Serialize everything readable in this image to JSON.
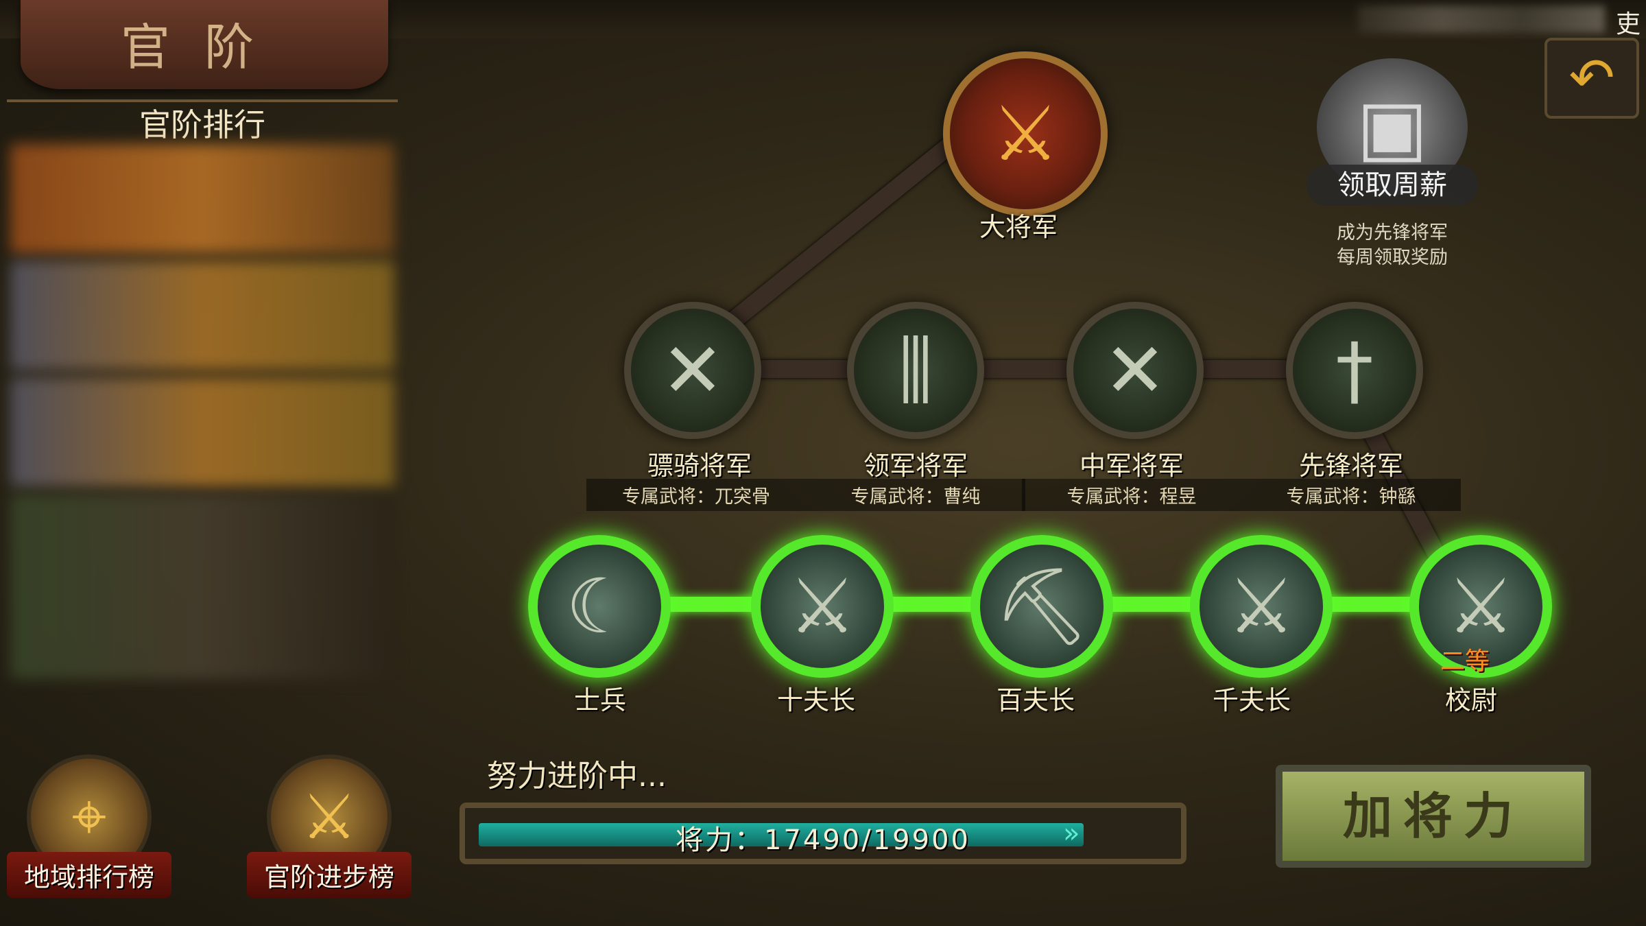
{
  "topbar": {
    "cut_text": "吏"
  },
  "header": {
    "title": "官阶"
  },
  "ranking": {
    "title": "官阶排行"
  },
  "top_tier": {
    "label": "大将军"
  },
  "weekly": {
    "button_label": "领取周薪",
    "note_line1": "成为先锋将军",
    "note_line2": "每周领取奖励"
  },
  "generals": [
    {
      "label": "骠骑将军",
      "exclusive": "专属武将：兀突骨"
    },
    {
      "label": "领军将军",
      "exclusive": "专属武将：曹纯"
    },
    {
      "label": "中军将军",
      "exclusive": "专属武将：程昱"
    },
    {
      "label": "先锋将军",
      "exclusive": "专属武将：钟繇"
    }
  ],
  "ranks": [
    {
      "label": "士兵"
    },
    {
      "label": "十夫长"
    },
    {
      "label": "百夫长"
    },
    {
      "label": "千夫长"
    },
    {
      "label": "校尉",
      "badge": "二等"
    }
  ],
  "progress": {
    "caption": "努力进阶中...",
    "text": "将力：17490/19900",
    "current": 17490,
    "max": 19900
  },
  "add_button": {
    "label": "加将力"
  },
  "bottom": {
    "region_label": "地域排行榜",
    "advance_label": "官阶进步榜"
  },
  "icons": {
    "undo": "undo-icon",
    "chest": "treasure-chest-icon",
    "region": "map-pin-icon",
    "advance": "crossed-swords-arrow-icon"
  },
  "colors": {
    "active_path": "#5ff52a",
    "progress_fill": "#1fb0a0"
  }
}
